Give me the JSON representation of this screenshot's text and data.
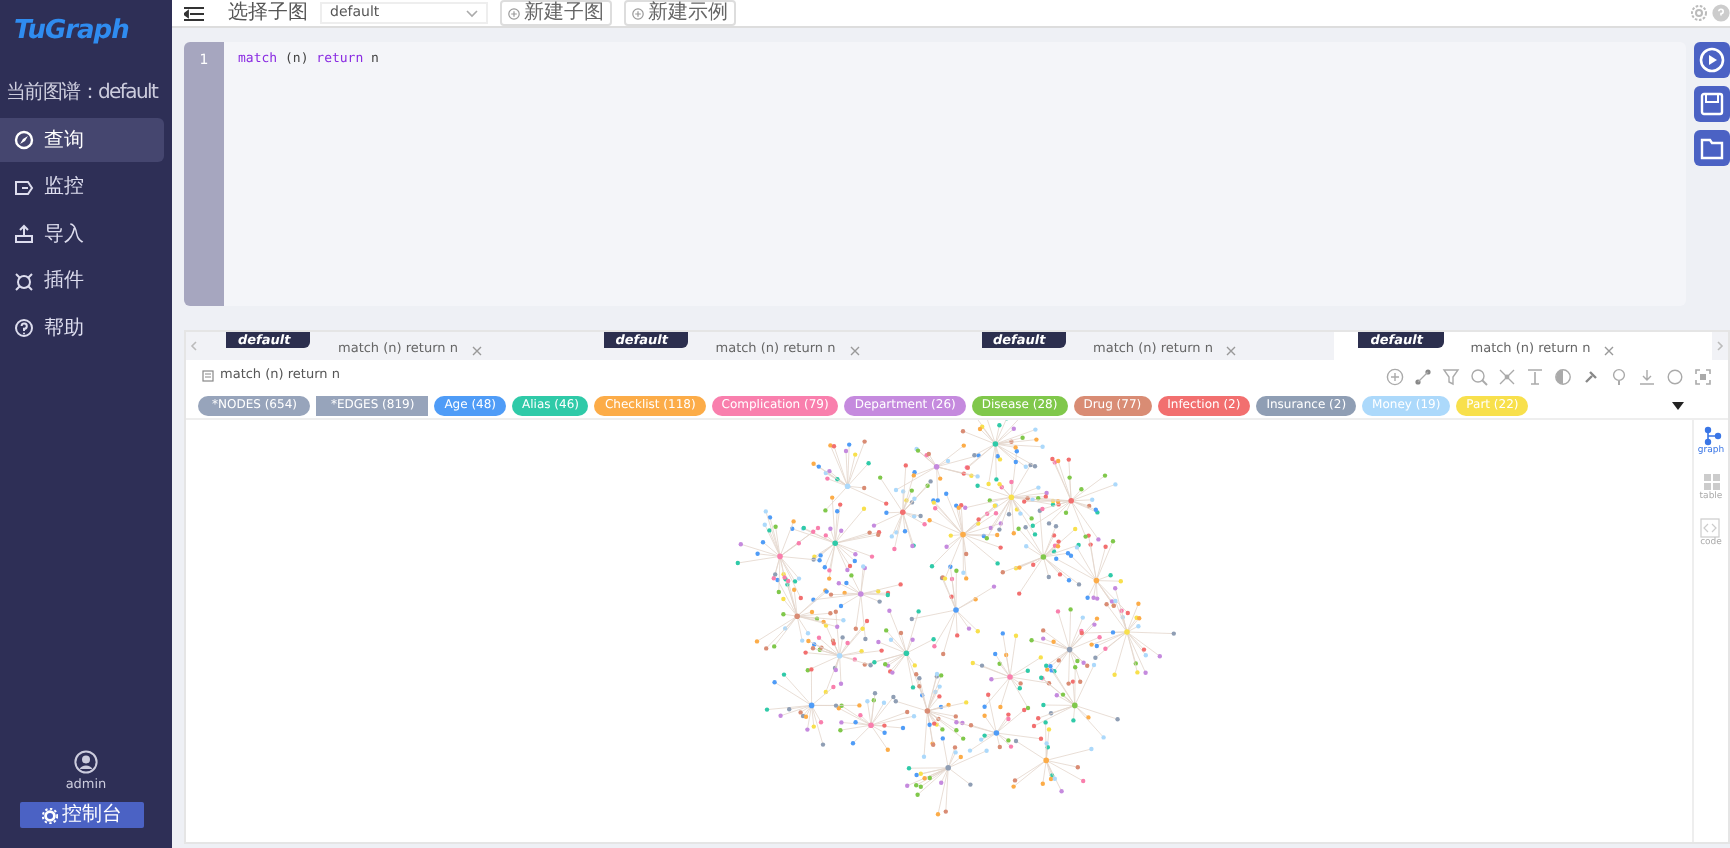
{
  "sidebar": {
    "logo": "TuGraph",
    "current_graph": "当前图谱：default",
    "items": [
      {
        "label": "查询",
        "selected": true
      },
      {
        "label": "监控",
        "selected": false
      },
      {
        "label": "导入",
        "selected": false
      },
      {
        "label": "插件",
        "selected": false
      },
      {
        "label": "帮助",
        "selected": false
      }
    ],
    "user": "admin",
    "console_button": "控制台"
  },
  "topbar": {
    "subgraph_label": "选择子图",
    "subgraph_value": "default",
    "buttons": [
      "新建子图",
      "新建示例"
    ]
  },
  "editor": {
    "line_numbers": [
      "1"
    ],
    "code": [
      {
        "kind": "keyword",
        "text": "match"
      },
      {
        "kind": "text",
        "text": " (n) "
      },
      {
        "kind": "keyword",
        "text": "return"
      },
      {
        "kind": "text",
        "text": " n"
      }
    ]
  },
  "result_tabs": [
    {
      "graph": "default",
      "query": "match (n) return n",
      "selected": false
    },
    {
      "graph": "default",
      "query": "match (n) return n",
      "selected": false
    },
    {
      "graph": "default",
      "query": "match (n) return n",
      "selected": false
    },
    {
      "graph": "default",
      "query": "match (n) return n",
      "selected": true
    }
  ],
  "result": {
    "title": "match (n) return n",
    "tags": [
      {
        "label": "*NODES (654)",
        "kind": "summary-pill",
        "color": "#97a4bb"
      },
      {
        "label": "*EDGES (819)",
        "kind": "summary-rect",
        "color": "#97a4bb"
      },
      {
        "label": "Age (48)",
        "kind": "label",
        "color": "#4f9cf7"
      },
      {
        "label": "Alias (46)",
        "kind": "label",
        "color": "#2fcaa8"
      },
      {
        "label": "Checklist (118)",
        "kind": "label",
        "color": "#fcac48"
      },
      {
        "label": "Complication (79)",
        "kind": "label",
        "color": "#f97fad"
      },
      {
        "label": "Department (26)",
        "kind": "label",
        "color": "#c58ade"
      },
      {
        "label": "Disease (28)",
        "kind": "label",
        "color": "#80c84b"
      },
      {
        "label": "Drug (77)",
        "kind": "label",
        "color": "#d98c74"
      },
      {
        "label": "Infection (2)",
        "kind": "label",
        "color": "#f26f6f"
      },
      {
        "label": "Insurance (2)",
        "kind": "label",
        "color": "#8f9eb4"
      },
      {
        "label": "Money (19)",
        "kind": "label",
        "color": "#acd9fb"
      },
      {
        "label": "Part (22)",
        "kind": "label",
        "color": "#f8e04c"
      }
    ],
    "views": [
      {
        "label": "graph",
        "selected": true
      },
      {
        "label": "table",
        "selected": false
      },
      {
        "label": "code",
        "selected": false
      }
    ]
  }
}
